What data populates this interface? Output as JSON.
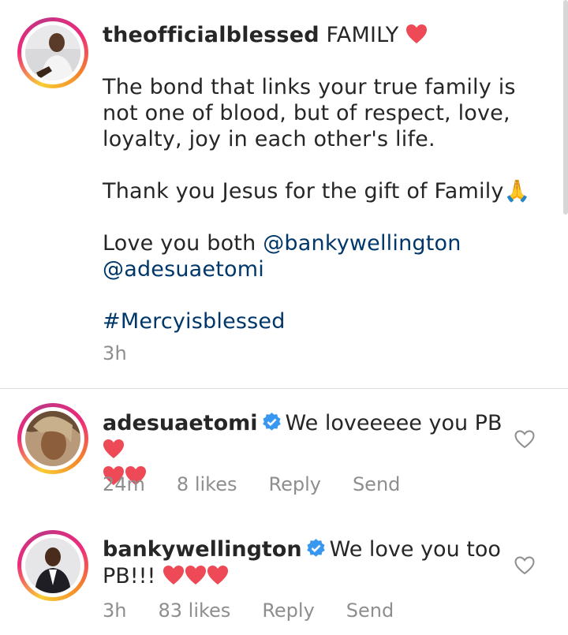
{
  "post": {
    "username": "theofficialblessed",
    "title": "FAMILY",
    "paragraph1": "The bond that links your true family is not one of blood, but of respect, love, loyalty, joy in each other's life.",
    "paragraph2": "Thank you Jesus for the gift of Family",
    "paragraph2_emoji": "🙏",
    "paragraph3_text": "Love you both",
    "mention1": "@bankywellington",
    "mention2": "@adesuaetomi",
    "hashtag": "#Mercyisblessed",
    "time": "3h"
  },
  "comments": [
    {
      "username": "adesuaetomi",
      "text": "We loveeeee you PB",
      "time": "24m",
      "likes": "8 likes",
      "reply_label": "Reply",
      "send_label": "Send"
    },
    {
      "username": "bankywellington",
      "text": "We love you too PB!!!",
      "time": "3h",
      "likes": "83 likes",
      "reply_label": "Reply",
      "send_label": "Send"
    }
  ],
  "colors": {
    "text": "#262626",
    "link": "#00376b",
    "meta": "#8e8e8e",
    "verified": "#3897f0",
    "heart": "#ed4956"
  },
  "icons": [
    "verified-badge-icon",
    "red-heart-emoji",
    "praying-hands-emoji",
    "heart-outline-icon"
  ]
}
